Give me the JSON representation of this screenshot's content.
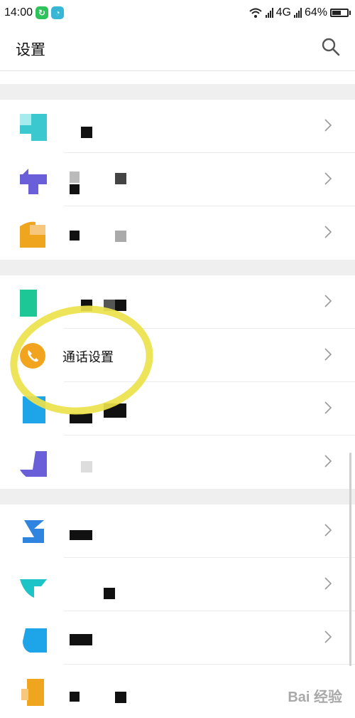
{
  "status_bar": {
    "time": "14:00",
    "network": "4G",
    "battery": "64%",
    "battery_level": 0.64
  },
  "header": {
    "title": "设置",
    "search_icon": "search-icon"
  },
  "colors": {
    "divider_gap": "#efefef",
    "highlight": "#ece24c",
    "call_icon": "#f3a41f"
  },
  "groups": [
    {
      "items": [
        {
          "name": "item-1",
          "icon_color": "#3cc8cf",
          "label": ""
        },
        {
          "name": "item-2",
          "icon_color": "#6a5fd8",
          "label": ""
        },
        {
          "name": "item-3",
          "icon_color": "#f0a51f",
          "label": ""
        }
      ]
    },
    {
      "items": [
        {
          "name": "item-4",
          "icon_color": "#1ec796",
          "label": ""
        },
        {
          "name": "call-settings",
          "icon_color": "#f3a41f",
          "label": "通话设置"
        },
        {
          "name": "item-6",
          "icon_color": "#1ea4e8",
          "label": ""
        },
        {
          "name": "item-7",
          "icon_color": "#6a5fd8",
          "label": ""
        }
      ]
    },
    {
      "items": [
        {
          "name": "item-8",
          "icon_color": "#2f84e0",
          "label": ""
        },
        {
          "name": "item-9",
          "icon_color": "#1cc3c7",
          "label": ""
        },
        {
          "name": "item-10",
          "icon_color": "#1ea4e8",
          "label": ""
        },
        {
          "name": "item-11",
          "icon_color": "#f0a51f",
          "label": ""
        }
      ]
    }
  ],
  "watermark": "Bai 经验"
}
